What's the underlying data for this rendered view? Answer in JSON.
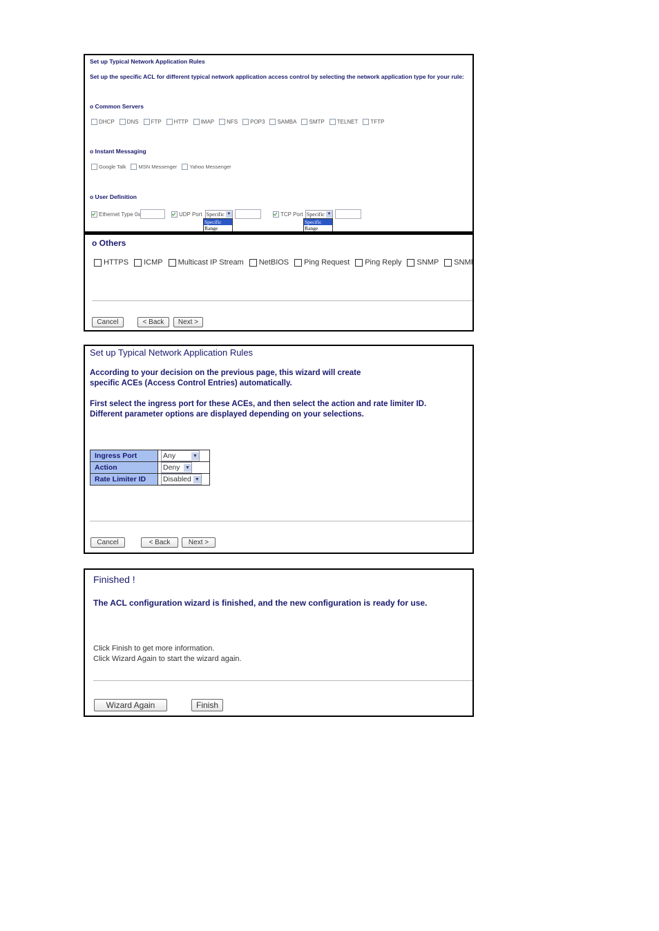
{
  "panel1": {
    "title": "Set up Typical Network Application Rules",
    "description": "Set up the specific ACL for different typical network application access control by selecting the network application type for your rule:",
    "common_servers": {
      "heading": "o Common Servers",
      "items": [
        {
          "label": "DHCP",
          "checked": false
        },
        {
          "label": "DNS",
          "checked": false
        },
        {
          "label": "FTP",
          "checked": false
        },
        {
          "label": "HTTP",
          "checked": false
        },
        {
          "label": "IMAP",
          "checked": false
        },
        {
          "label": "NFS",
          "checked": false
        },
        {
          "label": "POP3",
          "checked": false
        },
        {
          "label": "SAMBA",
          "checked": false
        },
        {
          "label": "SMTP",
          "checked": false
        },
        {
          "label": "TELNET",
          "checked": false
        },
        {
          "label": "TFTP",
          "checked": false
        }
      ]
    },
    "instant_messaging": {
      "heading": "o Instant Messaging",
      "items": [
        {
          "label": "Google Talk",
          "checked": false
        },
        {
          "label": "MSN Messenger",
          "checked": false
        },
        {
          "label": "Yahoo Messenger",
          "checked": false
        }
      ]
    },
    "user_definition": {
      "heading": "o User Definition",
      "ethernet": {
        "label": "Ethernet Type 0x",
        "checked": true,
        "value": ""
      },
      "udp": {
        "label": "UDP Port",
        "checked": true,
        "selected": "Specific",
        "options": [
          "Specific",
          "Range"
        ],
        "value": ""
      },
      "tcp": {
        "label": "TCP Port",
        "checked": true,
        "selected": "Specific",
        "options": [
          "Specific",
          "Range"
        ],
        "value": ""
      }
    },
    "others": {
      "heading": "o Others",
      "items": [
        {
          "label": "HTTPS",
          "checked": false
        },
        {
          "label": "ICMP",
          "checked": false
        },
        {
          "label": "Multicast IP Stream",
          "checked": false
        },
        {
          "label": "NetBIOS",
          "checked": false
        },
        {
          "label": "Ping Request",
          "checked": false
        },
        {
          "label": "Ping Reply",
          "checked": false
        },
        {
          "label": "SNMP",
          "checked": false
        },
        {
          "label": "SNMP Traps",
          "checked": false
        }
      ]
    },
    "buttons": {
      "cancel": "Cancel",
      "back": "< Back",
      "next": "Next >"
    }
  },
  "panel2": {
    "title": "Set up Typical Network Application Rules",
    "para1_line1": "According to your decision on the previous page, this wizard will create",
    "para1_line2": "specific ACEs (Access Control Entries) automatically.",
    "para2_line1": "First select the ingress port for these ACEs, and then select the action and rate limiter ID.",
    "para2_line2": "Different parameter options are displayed depending on your selections.",
    "params": [
      {
        "label": "Ingress Port",
        "value": "Any"
      },
      {
        "label": "Action",
        "value": "Deny"
      },
      {
        "label": "Rate Limiter ID",
        "value": "Disabled"
      }
    ],
    "buttons": {
      "cancel": "Cancel",
      "back": "< Back",
      "next": "Next >"
    }
  },
  "panel3": {
    "title": "Finished !",
    "message": "The ACL configuration wizard is finished, and the new configuration is ready for use.",
    "note_line1": "Click Finish to get more information.",
    "note_line2": "Click Wizard Again to start the wizard again.",
    "buttons": {
      "wizard_again": "Wizard Again",
      "finish": "Finish"
    }
  },
  "icons": {
    "dropdown": "chevron-down-icon",
    "checkbox": "checkbox-icon"
  }
}
